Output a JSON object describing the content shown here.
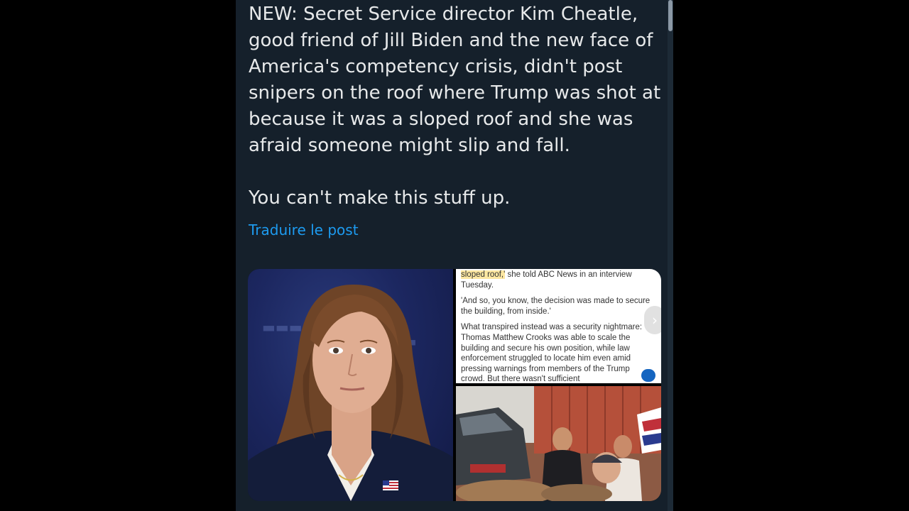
{
  "post": {
    "text_paragraphs": [
      "NEW: Secret Service director Kim Cheatle, good friend of Jill Biden and the new face of America's competency crisis, didn't post snipers on the roof where Trump was shot at because it was a sloped roof and she was afraid someone might slip and fall.",
      "You can't make this stuff up."
    ],
    "translate_link": "Traduire le post"
  },
  "media": {
    "article_snippet": {
      "highlight": "sloped roof,'",
      "line1_rest": " she told ABC News in an interview Tuesday.",
      "para2": "'And so, you know, the decision was made to secure the building, from inside.'",
      "para3": "What transpired instead was a security nightmare: Thomas Matthew Crooks was able to scale the building and secure his own position, while law enforcement struggled to locate him even amid pressing warnings from members of the Trump crowd.  But there wasn't sufficient"
    },
    "next_icon": "chevron-right-icon"
  },
  "colors": {
    "background": "#15202b",
    "text": "#e7e9ea",
    "link": "#1d9bf0",
    "page": "#000000"
  }
}
